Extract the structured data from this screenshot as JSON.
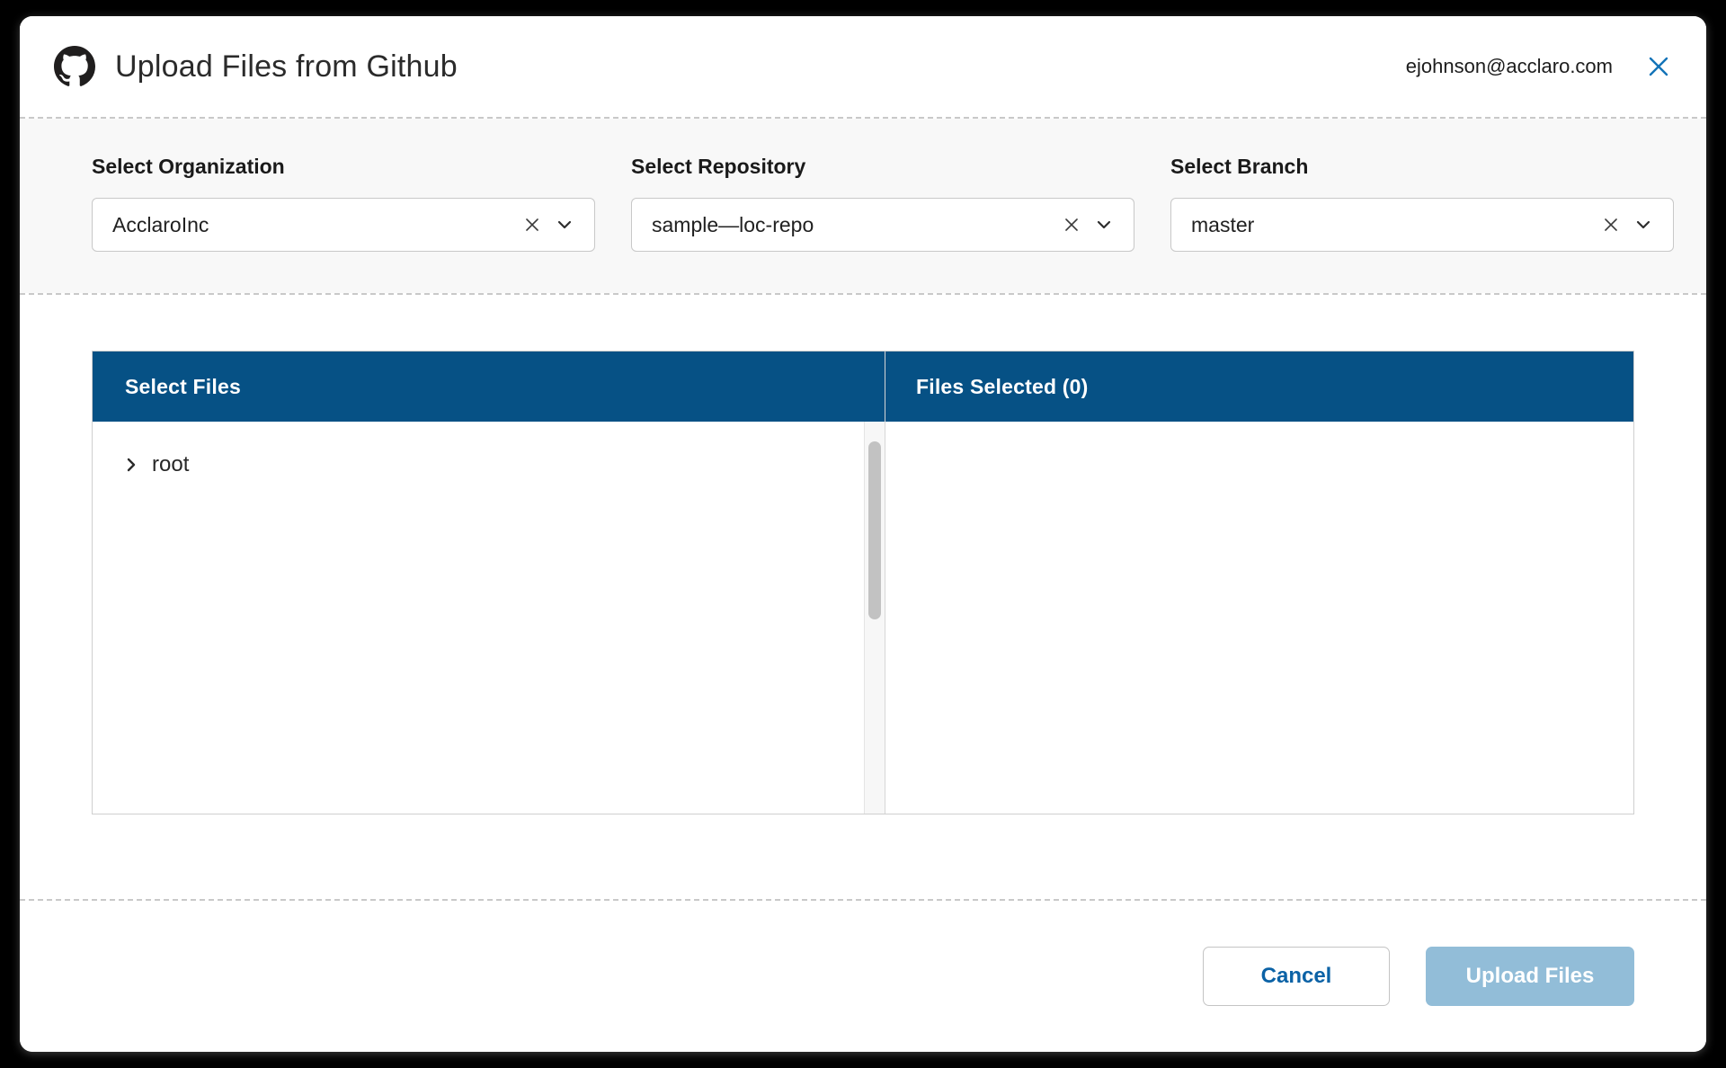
{
  "window": {
    "title": "Upload Files from Github",
    "logo_icon": "github-mark-icon",
    "account_email": "ejohnson@acclaro.com",
    "close_icon": "close-icon",
    "accent_blue": "#065185",
    "link_blue": "#0b62a6",
    "disabled_blue": "#92bdd8"
  },
  "selectors": [
    {
      "label": "Select Organization",
      "value": "AcclaroInc",
      "clear_icon": "clear-x-icon",
      "caret_icon": "chevron-down-icon"
    },
    {
      "label": "Select Repository",
      "value": "sample—loc-repo",
      "clear_icon": "clear-x-icon",
      "caret_icon": "chevron-down-icon"
    },
    {
      "label": "Select Branch",
      "value": "master",
      "clear_icon": "clear-x-icon",
      "caret_icon": "chevron-down-icon"
    }
  ],
  "panels": {
    "left": {
      "header": "Select Files",
      "tree": [
        {
          "label": "root",
          "caret_icon": "chevron-right-icon",
          "expanded": false
        }
      ]
    },
    "right": {
      "header": "Files Selected (0)",
      "items": []
    }
  },
  "footer": {
    "cancel_label": "Cancel",
    "upload_label": "Upload Files"
  }
}
